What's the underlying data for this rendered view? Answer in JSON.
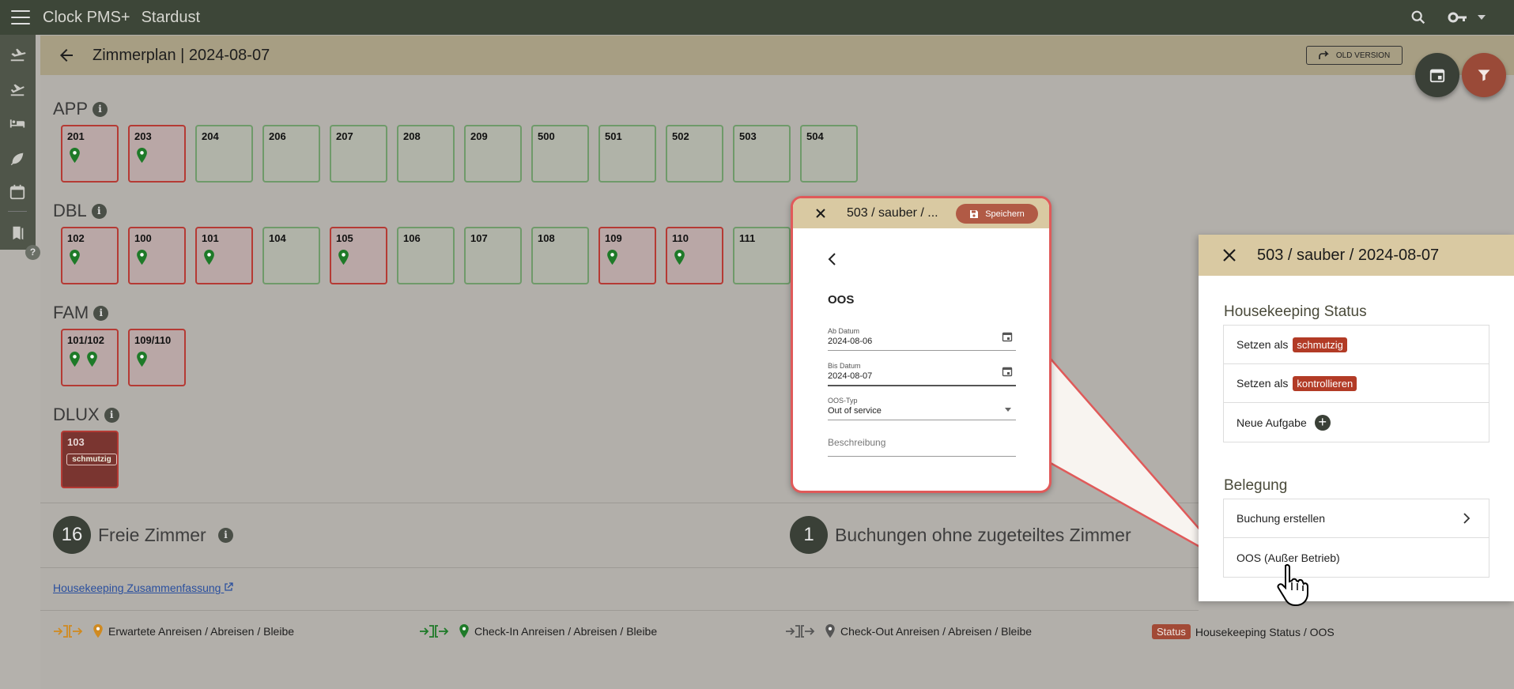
{
  "topbar": {
    "app_title": "Clock PMS+",
    "hotel_name": "Stardust"
  },
  "header": {
    "title": "Zimmerplan | 2024-08-07",
    "old_version_label": "OLD VERSION"
  },
  "categories": [
    {
      "name": "APP",
      "info": "i"
    },
    {
      "name": "DBL",
      "info": "i"
    },
    {
      "name": "FAM",
      "info": "i"
    },
    {
      "name": "DLUX",
      "info": "i"
    }
  ],
  "rooms": {
    "app": [
      {
        "number": "201",
        "pins": 1
      },
      {
        "number": "203",
        "pins": 1
      },
      {
        "number": "204"
      },
      {
        "number": "206"
      },
      {
        "number": "207"
      },
      {
        "number": "208"
      },
      {
        "number": "209"
      },
      {
        "number": "500"
      },
      {
        "number": "501"
      },
      {
        "number": "502"
      },
      {
        "number": "503"
      },
      {
        "number": "504"
      }
    ],
    "dbl": [
      {
        "number": "102",
        "pins": 1
      },
      {
        "number": "100",
        "pins": 1
      },
      {
        "number": "101",
        "pins": 1
      },
      {
        "number": "104"
      },
      {
        "number": "105",
        "pins": 1
      },
      {
        "number": "106"
      },
      {
        "number": "107"
      },
      {
        "number": "108"
      },
      {
        "number": "109",
        "pins": 1
      },
      {
        "number": "110",
        "pins": 1
      },
      {
        "number": "111"
      }
    ],
    "fam": [
      {
        "number": "101/102",
        "pins": 2
      },
      {
        "number": "109/110",
        "pins": 1
      }
    ],
    "dlux": [
      {
        "number": "103",
        "status": "schmutzig"
      }
    ]
  },
  "summary": {
    "free_count": "16",
    "free_label": "Freie Zimmer",
    "unassigned_count": "1",
    "unassigned_label": "Buchungen ohne zugeteiltes Zimmer"
  },
  "hk_link": "Housekeeping Zusammenfassung",
  "legend": {
    "expected": "Erwartete Anreisen / Abreisen / Bleibe",
    "checkin": "Check-In Anreisen / Abreisen / Bleibe",
    "checkout": "Check-Out Anreisen / Abreisen / Bleibe",
    "status_chip": "Status",
    "status_label": "Housekeeping Status / OOS"
  },
  "panel": {
    "title": "503 / sauber / 2024-08-07",
    "hk_section": "Housekeeping Status",
    "set_as": "Setzen als",
    "dirty_chip": "schmutzig",
    "checked_chip": "kontrollieren",
    "new_task": "Neue Aufgabe",
    "plus": "+",
    "occupancy_section": "Belegung",
    "create_booking": "Buchung erstellen",
    "oos": "OOS (Außer Betrieb)"
  },
  "zoom": {
    "title": "503 / sauber / ...",
    "save_label": "Speichern",
    "oos_title": "OOS",
    "from_label": "Ab Datum",
    "from_value": "2024-08-06",
    "to_label": "Bis Datum",
    "to_value": "2024-08-07",
    "type_label": "OOS-Typ",
    "type_value": "Out of service",
    "description_placeholder": "Beschreibung"
  },
  "colors": {
    "topbar": "#3d4638",
    "header": "#a79e83",
    "accent_red": "#b23b26",
    "pin_green": "#1e7a28",
    "pin_orange": "#d08a20"
  }
}
